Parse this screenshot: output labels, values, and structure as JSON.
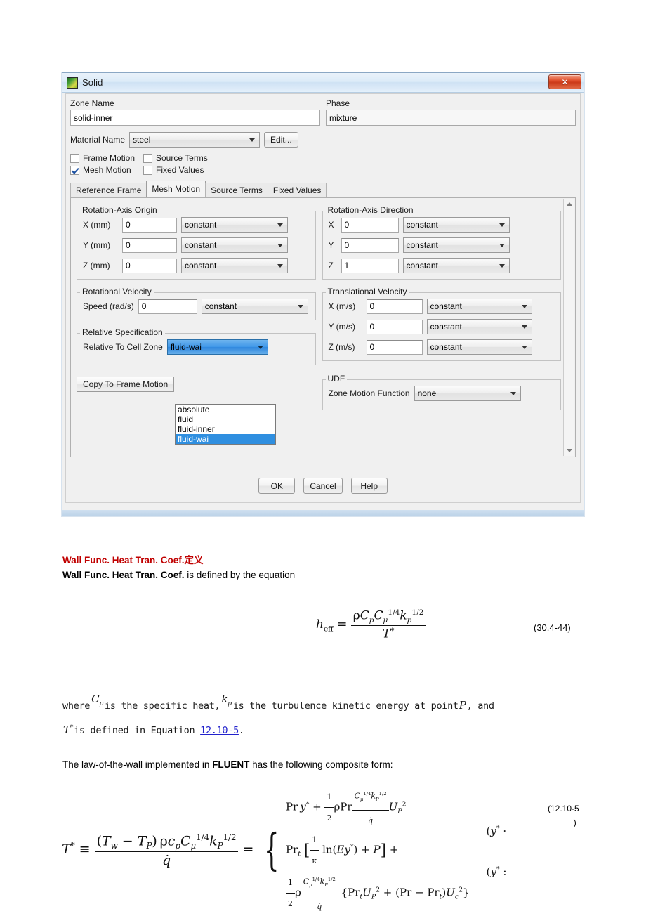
{
  "dialog": {
    "title": "Solid",
    "icon": "fluent-zone-icon",
    "close_label": "✕",
    "zone_name": {
      "label": "Zone Name",
      "value": "solid-inner"
    },
    "phase": {
      "label": "Phase",
      "value": "mixture"
    },
    "material": {
      "label": "Material Name",
      "value": "steel",
      "edit_button": "Edit..."
    },
    "checkboxes": [
      {
        "label": "Frame Motion",
        "checked": false
      },
      {
        "label": "Source Terms",
        "checked": false
      },
      {
        "label": "Mesh Motion",
        "checked": true
      },
      {
        "label": "Fixed Values",
        "checked": false
      }
    ],
    "tabs": [
      {
        "label": "Reference Frame",
        "active": false
      },
      {
        "label": "Mesh Motion",
        "active": true
      },
      {
        "label": "Source Terms",
        "active": false
      },
      {
        "label": "Fixed Values",
        "active": false
      }
    ],
    "rotation_axis_origin": {
      "title": "Rotation-Axis Origin",
      "rows": [
        {
          "label": "X (mm)",
          "value": "0",
          "profile": "constant"
        },
        {
          "label": "Y (mm)",
          "value": "0",
          "profile": "constant"
        },
        {
          "label": "Z (mm)",
          "value": "0",
          "profile": "constant"
        }
      ]
    },
    "rotation_axis_direction": {
      "title": "Rotation-Axis Direction",
      "rows": [
        {
          "label": "X",
          "value": "0",
          "profile": "constant"
        },
        {
          "label": "Y",
          "value": "0",
          "profile": "constant"
        },
        {
          "label": "Z",
          "value": "1",
          "profile": "constant"
        }
      ]
    },
    "rotational_velocity": {
      "title": "Rotational Velocity",
      "rows": [
        {
          "label": "Speed (rad/s)",
          "value": "0",
          "profile": "constant"
        }
      ]
    },
    "translational_velocity": {
      "title": "Translational Velocity",
      "rows": [
        {
          "label": "X (m/s)",
          "value": "0",
          "profile": "constant"
        },
        {
          "label": "Y (m/s)",
          "value": "0",
          "profile": "constant"
        },
        {
          "label": "Z (m/s)",
          "value": "0",
          "profile": "constant"
        }
      ]
    },
    "relative_specification": {
      "title": "Relative Specification",
      "label": "Relative To Cell Zone",
      "value": "fluid-wai",
      "options": [
        "absolute",
        "fluid",
        "fluid-inner",
        "fluid-wai"
      ],
      "selected_option": "fluid-wai"
    },
    "udf": {
      "title": "UDF",
      "label": "Zone Motion Function",
      "value": "none"
    },
    "copy_button": "Copy To Frame Motion",
    "footer_buttons": [
      "OK",
      "Cancel",
      "Help"
    ]
  },
  "document": {
    "heading_red_en": "Wall Func. Heat Tran. Coef.",
    "heading_red_cjk": "定义",
    "line2_bold": "Wall Func. Heat Tran. Coef.",
    "line2_rest": " is defined by the equation",
    "equation_1_number": "(30.4-44)",
    "where_prefix": "where",
    "where_mid": "is the specific heat,",
    "where_mid2": "is the turbulence kinetic energy at point",
    "where_end": ", and",
    "where2_pre": "is defined in Equation",
    "where2_link": "12.10-5",
    "where2_end": ".",
    "fluent_line_a": "The law-of-the-wall implemented in ",
    "fluent_line_b": "FLUENT",
    "fluent_line_c": " has the following composite form:",
    "equation_2_number_open": "(12.10-5",
    "equation_2_number_close": ")"
  },
  "colors": {
    "heading_red": "#c00000",
    "link_blue": "#2222cc",
    "select_blue": "#2f8fe0",
    "close_red": "#cc3a18"
  }
}
